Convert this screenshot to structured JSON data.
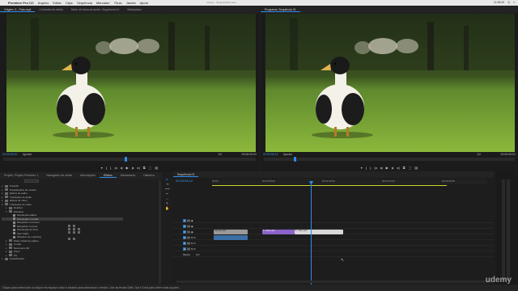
{
  "menubar": {
    "app_name": "Premiere Pro CC",
    "items": [
      "Arquivo",
      "Editar",
      "Clipe",
      "Sequência",
      "Marcador",
      "Título",
      "Janela",
      "Ajuda"
    ],
    "path": "/Users/.../Projetos/Premiere",
    "right": [
      "11:08:00",
      "Q",
      "≡"
    ]
  },
  "source_tabs": [
    "Origem: 3 - Pato.mp4",
    "Controles de efeito",
    "Mixer de faixa de áudio: Sequência 01",
    "Metadados"
  ],
  "program_tabs": [
    "Programa: Sequência 01"
  ],
  "source_monitor": {
    "timecode": "00:00:00:00",
    "fit": "Ajustar",
    "fraction": "1/2",
    "timecode_right": "00:00:00:01",
    "playhead_pct": 48
  },
  "program_monitor": {
    "timecode": "00:00:06:12",
    "fit": "Ajustar",
    "fraction": "1/2",
    "timecode_right": "00:00:00:01",
    "playhead_pct": 12
  },
  "transport": [
    "▾",
    "{",
    "}",
    "|◂",
    "◂|",
    "▶",
    "|▸",
    "▸|",
    "⧉",
    "⬚",
    "▤"
  ],
  "project_tabs": [
    "Projeto: Projeto Premiere 1",
    "Navegador de mídia",
    "Informações",
    "Efeitos",
    "Marcadores",
    "Histórico"
  ],
  "effects_tree": [
    {
      "label": "Predefin.",
      "indent": 0,
      "open": false
    },
    {
      "label": "Predefinições de usuário",
      "indent": 0,
      "open": false
    },
    {
      "label": "Efeitos de áudio",
      "indent": 0,
      "open": false
    },
    {
      "label": "Transições de áudio",
      "indent": 0,
      "open": false
    },
    {
      "label": "Efeitos de vídeo",
      "indent": 0,
      "open": false
    },
    {
      "label": "Transições de vídeo",
      "indent": 0,
      "open": true
    },
    {
      "label": "Deslizar",
      "indent": 1,
      "open": false
    },
    {
      "label": "Dissolver",
      "indent": 1,
      "open": true
    },
    {
      "label": "Dissolução aditiva",
      "indent": 2,
      "open": false,
      "item": true
    },
    {
      "label": "Dissolução cruzada",
      "indent": 2,
      "open": false,
      "item": true,
      "selected": true
    },
    {
      "label": "Mergulhar no branco",
      "indent": 2,
      "open": false,
      "item": true
    },
    {
      "label": "Mergulhar no preto",
      "indent": 2,
      "open": false,
      "item": true
    },
    {
      "label": "Dissolução de filme",
      "indent": 2,
      "open": false,
      "item": true
    },
    {
      "label": "Sem fusão",
      "indent": 2,
      "open": false,
      "item": true
    },
    {
      "label": "Dissolver de morphing",
      "indent": 2,
      "open": false,
      "item": true
    },
    {
      "label": "Efeito virada de página",
      "indent": 1,
      "open": false
    },
    {
      "label": "Limpar",
      "indent": 1,
      "open": false
    },
    {
      "label": "Movimento 3D",
      "indent": 1,
      "open": false
    },
    {
      "label": "Zoom",
      "indent": 1,
      "open": false
    },
    {
      "label": "Íris",
      "indent": 1,
      "open": false
    },
    {
      "label": "Predefinições",
      "indent": 0,
      "open": false
    }
  ],
  "timeline": {
    "tab": "Sequência 01",
    "timecode": "00:00:06:12",
    "ruler": [
      "00:00",
      "00:00:05:00",
      "00:00:10:00",
      "00:00:15:00",
      "00:00:20:00"
    ],
    "tracks": [
      {
        "name": "V3",
        "row": 0
      },
      {
        "name": "V2",
        "row": 1
      },
      {
        "name": "V1",
        "row": 2
      },
      {
        "name": "A1",
        "row": 3
      },
      {
        "name": "A2",
        "row": 4
      },
      {
        "name": "A3",
        "row": 5
      },
      {
        "name": "Mestre",
        "row": 6
      }
    ],
    "clips": [
      {
        "label": "Gansos.mp4",
        "type": "grey"
      },
      {
        "label": "4 - Pato.mp4",
        "type": "v"
      },
      {
        "label": "2 - Pato.mp4",
        "type": "light"
      }
    ],
    "master_value": "0,0"
  },
  "statusbar": "Clique para selecionar ou clique em espaço vazio e arraste para selecionar o trecho. Use as teclas Shift, Opt e Cmd para obter mais opções.",
  "watermark": "udemy"
}
